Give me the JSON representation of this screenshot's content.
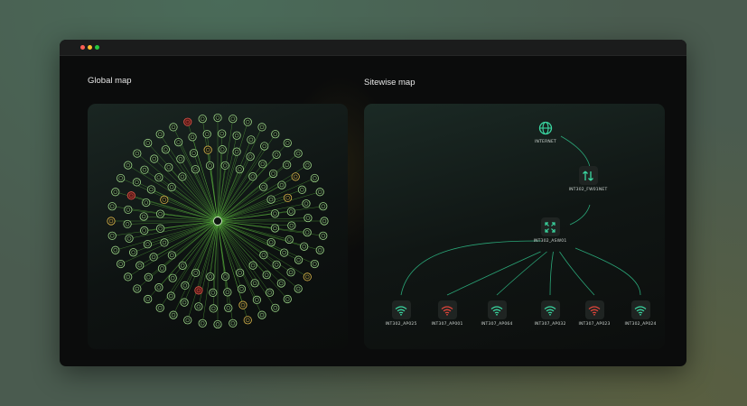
{
  "window": {
    "title_controls": [
      "close",
      "minimize",
      "maximize"
    ]
  },
  "global_map": {
    "heading": "Global map",
    "node_colors": {
      "normal": "#9fd98a",
      "warning": "#e0b94a",
      "error": "#e0554a"
    },
    "edge_color": "#5fbf3f"
  },
  "sitewise_map": {
    "heading": "Sitewise map",
    "internet": {
      "label": "INTERNET",
      "icon": "globe-icon"
    },
    "firewall": {
      "label": "INT302_FW01NET",
      "icon": "arrows-updown-icon"
    },
    "switch": {
      "label": "INT302_ASW01",
      "icon": "expand-icon"
    },
    "access_points": [
      {
        "label": "INT302_AP025",
        "status": "ok"
      },
      {
        "label": "INT307_AP001",
        "status": "error"
      },
      {
        "label": "INT307_AP064",
        "status": "ok"
      },
      {
        "label": "INT307_AP032",
        "status": "ok"
      },
      {
        "label": "INT307_AP023",
        "status": "error"
      },
      {
        "label": "INT302_AP024",
        "status": "ok"
      }
    ],
    "colors": {
      "ok": "#3ad6a0",
      "error": "#e0453a",
      "edge": "#2fbf8a"
    }
  }
}
